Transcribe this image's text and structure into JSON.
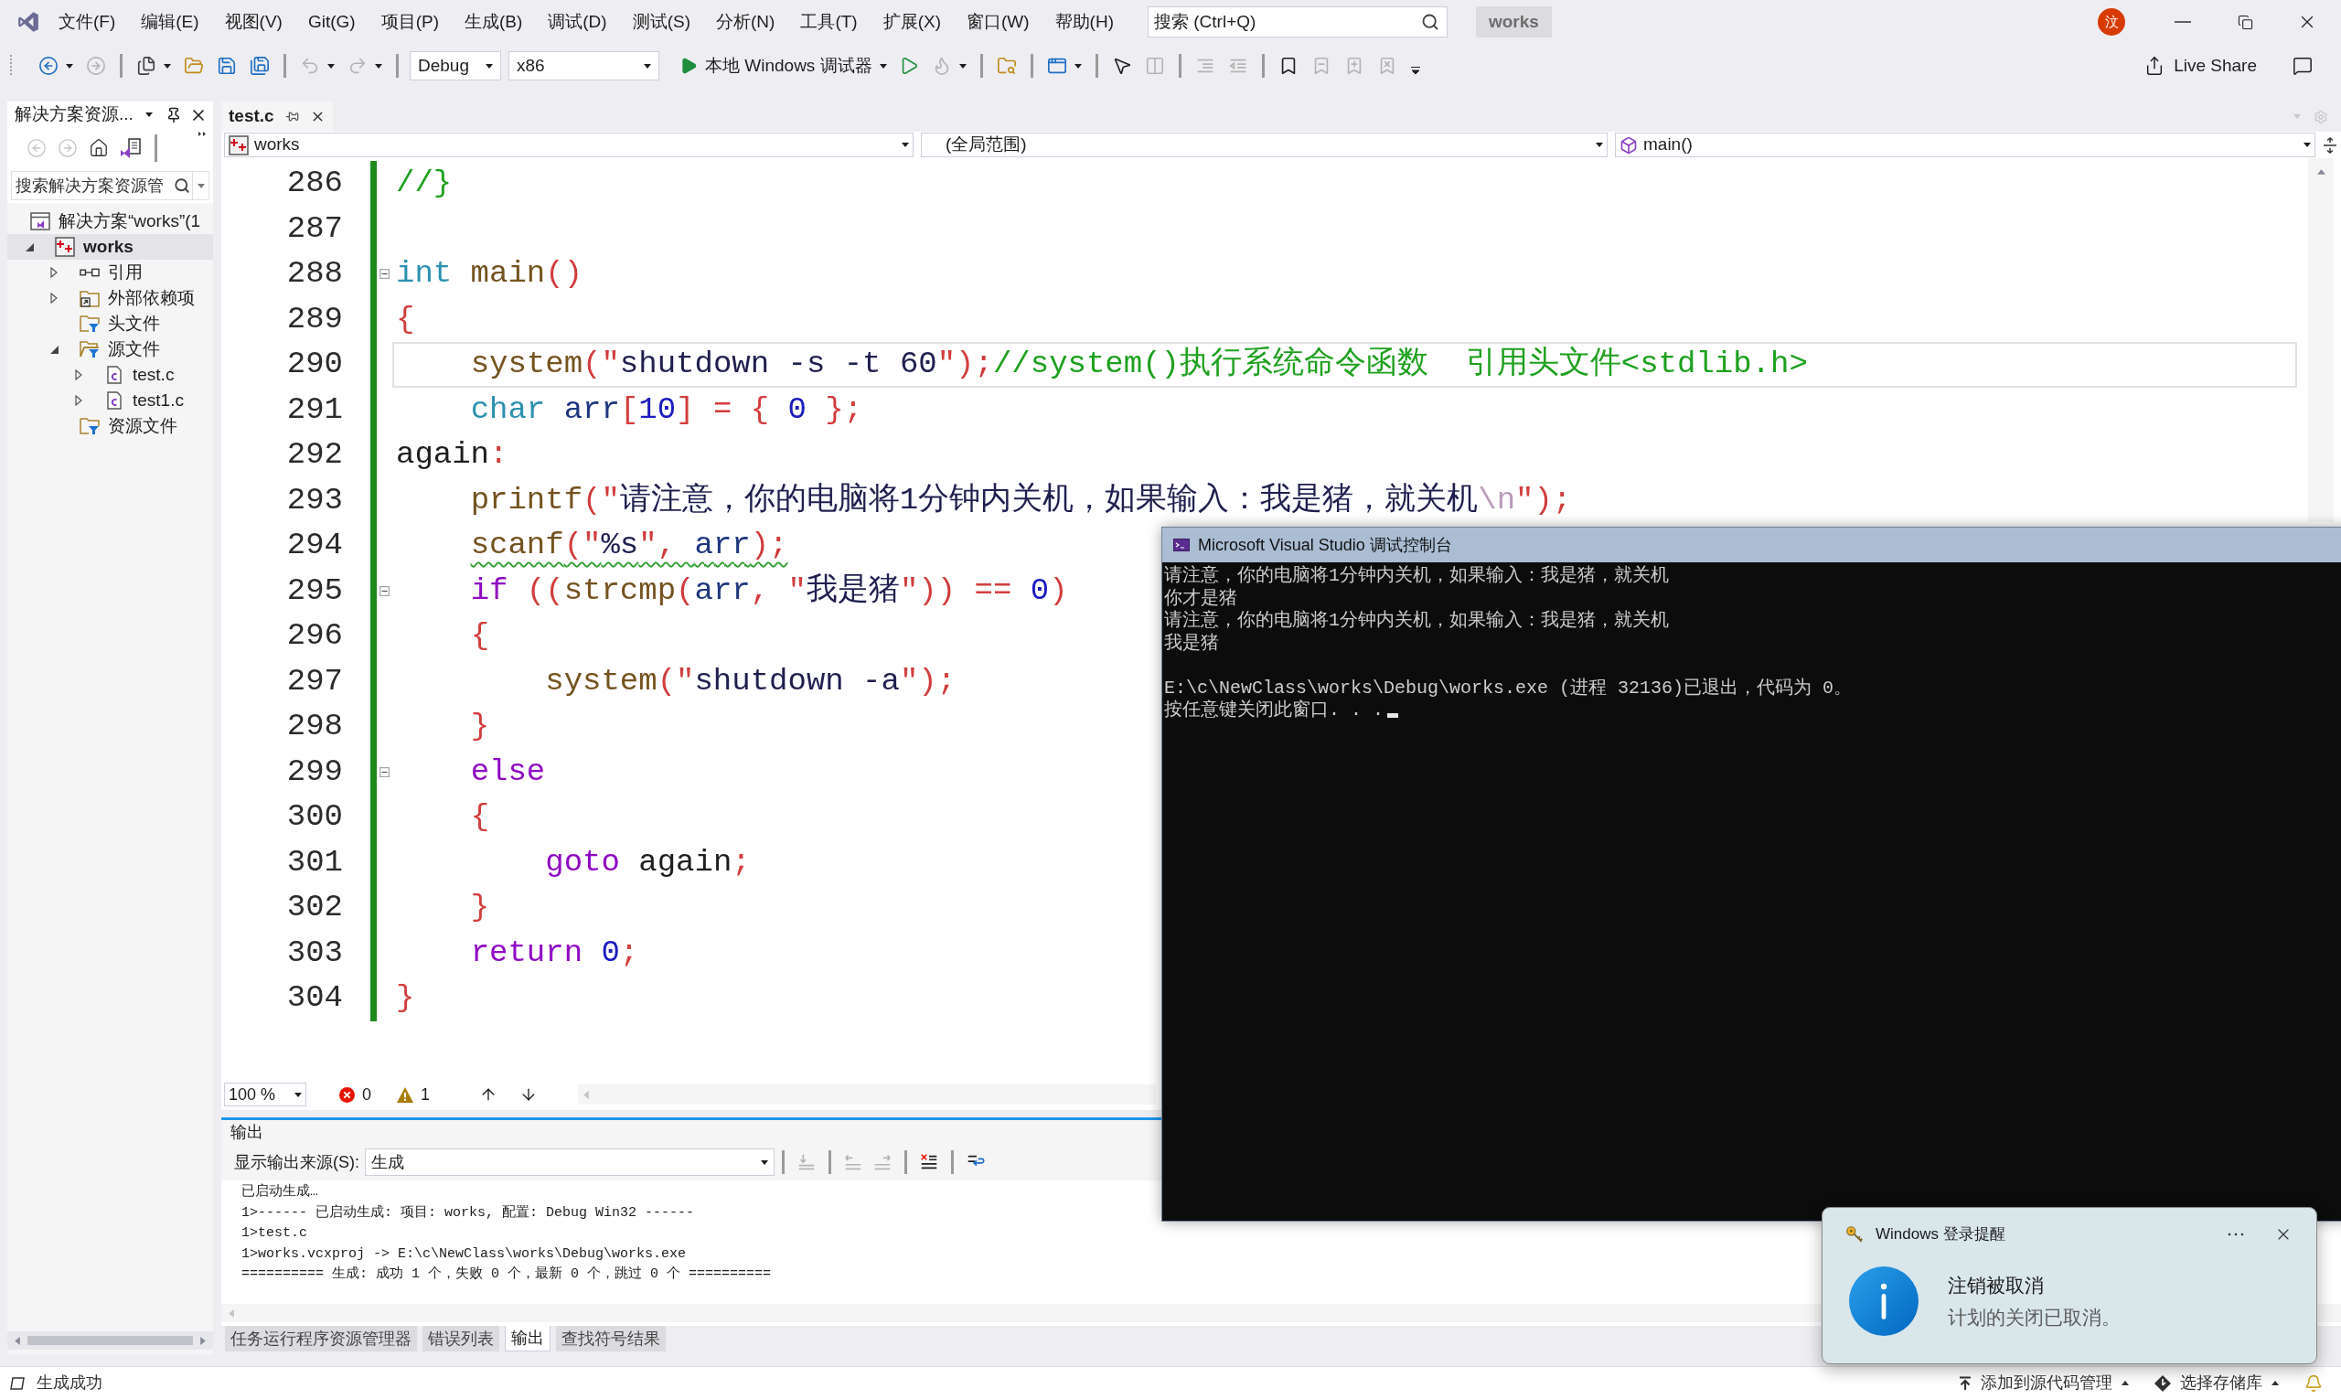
{
  "menu_bar": {
    "items": [
      "文件(F)",
      "编辑(E)",
      "视图(V)",
      "Git(G)",
      "项目(P)",
      "生成(B)",
      "调试(D)",
      "测试(S)",
      "分析(N)",
      "工具(T)",
      "扩展(X)",
      "窗口(W)",
      "帮助(H)"
    ],
    "search": {
      "placeholder": "搜索 (Ctrl+Q)"
    },
    "solution": "works",
    "avatar": "汶"
  },
  "toolbar": {
    "groups": [
      [
        {
          "kind": "back",
          "disabled": false,
          "menu": true
        },
        {
          "kind": "forward",
          "disabled": true,
          "menu": false
        }
      ],
      [
        {
          "kind": "new",
          "disabled": false,
          "menu": true
        },
        {
          "kind": "open",
          "disabled": false,
          "menu": false
        },
        {
          "kind": "save",
          "disabled": false,
          "menu": false
        },
        {
          "kind": "saveall",
          "disabled": false,
          "menu": false
        }
      ],
      [
        {
          "kind": "undo",
          "disabled": true,
          "menu": true
        },
        {
          "kind": "redo",
          "disabled": true,
          "menu": true
        }
      ],
      [
        {
          "kind": "select",
          "value": "Debug"
        },
        {
          "kind": "select",
          "value": "x86"
        },
        {
          "kind": "run",
          "label": "本地 Windows 调试器",
          "disabled": false,
          "menu": true
        },
        {
          "kind": "runnodebug",
          "disabled": false,
          "menu": false
        },
        {
          "kind": "hotreload",
          "disabled": true,
          "menu": true
        }
      ],
      [
        {
          "kind": "findfiles",
          "disabled": false,
          "menu": false
        }
      ],
      [
        {
          "kind": "layout",
          "disabled": false,
          "menu": true
        }
      ],
      [
        {
          "kind": "pointer",
          "disabled": false,
          "menu": false
        },
        {
          "kind": "columns",
          "disabled": true,
          "menu": false
        }
      ],
      [
        {
          "kind": "indent",
          "disabled": true,
          "menu": false
        },
        {
          "kind": "outdent",
          "disabled": true,
          "menu": false
        }
      ],
      [
        {
          "kind": "bookmark",
          "disabled": false,
          "menu": false
        },
        {
          "kind": "bookmarkprev",
          "disabled": true,
          "menu": false
        },
        {
          "kind": "bookmarknext",
          "disabled": true,
          "menu": false
        },
        {
          "kind": "bookmarkclear",
          "disabled": true,
          "menu": false
        }
      ]
    ],
    "live_share": "Live Share"
  },
  "solution_explorer": {
    "title": "解决方案资源...",
    "tools": [
      {
        "kind": "back",
        "disabled": true
      },
      {
        "kind": "forward",
        "disabled": true
      },
      {
        "kind": "home",
        "disabled": false
      },
      {
        "kind": "views",
        "disabled": false
      }
    ],
    "search": {
      "placeholder": "搜索解决方案资源管"
    },
    "tree": [
      {
        "label": "解决方案“works”(1",
        "kind": "solution",
        "selected": false,
        "children": [
          {
            "label": "works",
            "kind": "project",
            "expanded": true,
            "selected": true,
            "children": [
              {
                "label": "引用",
                "kind": "references",
                "expanded": false,
                "selected": false
              },
              {
                "label": "外部依赖项",
                "kind": "external",
                "expanded": false,
                "selected": false
              },
              {
                "label": "头文件",
                "kind": "filter",
                "selected": false
              },
              {
                "label": "源文件",
                "kind": "filter",
                "expanded": true,
                "selected": false,
                "children": [
                  {
                    "label": "test.c",
                    "kind": "file",
                    "expanded": false,
                    "selected": false
                  },
                  {
                    "label": "test1.c",
                    "kind": "file",
                    "expanded": false,
                    "selected": false
                  }
                ]
              },
              {
                "label": "资源文件",
                "kind": "filter",
                "selected": false
              }
            ]
          }
        ]
      }
    ]
  },
  "editor": {
    "tabs": [
      {
        "label": "test.c",
        "selected": true
      }
    ],
    "navigation": {
      "project": "works",
      "scope": "(全局范围)",
      "member": "main()"
    },
    "lines": [
      {
        "number": "286",
        "fold": false,
        "current": false,
        "warning": false,
        "tokens": [
          {
            "kind": "comment",
            "text": "//}"
          }
        ]
      },
      {
        "number": "287",
        "fold": false,
        "current": false,
        "warning": false
      },
      {
        "number": "288",
        "fold": true,
        "current": false,
        "warning": false,
        "tokens": [
          {
            "kind": "type",
            "text": "int"
          },
          {
            "kind": "function",
            "text": " main"
          },
          {
            "kind": "punct",
            "text": "()"
          }
        ]
      },
      {
        "number": "289",
        "fold": false,
        "current": false,
        "warning": false,
        "tokens": [
          {
            "kind": "punct",
            "text": "{"
          }
        ]
      },
      {
        "number": "290",
        "fold": false,
        "current": true,
        "warning": false,
        "tokens": [
          {
            "kind": "function",
            "text": "    system"
          },
          {
            "kind": "punct",
            "text": "(\""
          },
          {
            "kind": "string",
            "text": "shutdown -s -t 60"
          },
          {
            "kind": "punct",
            "text": "\");"
          },
          {
            "kind": "comment",
            "text": "//system()执行系统命令函数  引用头文件<stdlib.h>"
          }
        ]
      },
      {
        "number": "291",
        "fold": false,
        "current": false,
        "warning": false,
        "tokens": [
          {
            "kind": "type",
            "text": "    char"
          },
          {
            "kind": "variable",
            "text": " arr"
          },
          {
            "kind": "punct",
            "text": "["
          },
          {
            "kind": "number",
            "text": "10"
          },
          {
            "kind": "punct",
            "text": "] = { "
          },
          {
            "kind": "number",
            "text": "0"
          },
          {
            "kind": "punct",
            "text": " };"
          }
        ]
      },
      {
        "number": "292",
        "fold": false,
        "current": false,
        "warning": false,
        "tokens": [
          {
            "kind": "plain",
            "text": "again"
          },
          {
            "kind": "punct",
            "text": ":"
          }
        ]
      },
      {
        "number": "293",
        "fold": false,
        "current": false,
        "warning": false,
        "tokens": [
          {
            "kind": "function",
            "text": "    printf"
          },
          {
            "kind": "punct",
            "text": "(\""
          },
          {
            "kind": "string",
            "text": "请注意，你的电脑将1分钟内关机，如果输入：我是猪，就关机"
          },
          {
            "kind": "escape",
            "text": "\\n"
          },
          {
            "kind": "punct",
            "text": "\");"
          }
        ]
      },
      {
        "number": "294",
        "fold": false,
        "current": false,
        "warning": true,
        "tokens": [
          {
            "kind": "function",
            "text": "    scanf"
          },
          {
            "kind": "punct",
            "text": "(\""
          },
          {
            "kind": "string",
            "text": "%s"
          },
          {
            "kind": "punct",
            "text": "\", "
          },
          {
            "kind": "variable",
            "text": "arr"
          },
          {
            "kind": "punct",
            "text": ");"
          }
        ]
      },
      {
        "number": "295",
        "fold": true,
        "current": false,
        "warning": false,
        "tokens": [
          {
            "kind": "control",
            "text": "    if"
          },
          {
            "kind": "punct",
            "text": " (("
          },
          {
            "kind": "function",
            "text": "strcmp"
          },
          {
            "kind": "punct",
            "text": "("
          },
          {
            "kind": "variable",
            "text": "arr"
          },
          {
            "kind": "punct",
            "text": ", \""
          },
          {
            "kind": "string",
            "text": "我是猪"
          },
          {
            "kind": "punct",
            "text": "\")) == "
          },
          {
            "kind": "number",
            "text": "0"
          },
          {
            "kind": "punct",
            "text": ")"
          }
        ]
      },
      {
        "number": "296",
        "fold": false,
        "current": false,
        "warning": false,
        "tokens": [
          {
            "kind": "punct",
            "text": "    {"
          }
        ]
      },
      {
        "number": "297",
        "fold": false,
        "current": false,
        "warning": false,
        "tokens": [
          {
            "kind": "function",
            "text": "        system"
          },
          {
            "kind": "punct",
            "text": "(\""
          },
          {
            "kind": "string",
            "text": "shutdown -a"
          },
          {
            "kind": "punct",
            "text": "\");"
          }
        ]
      },
      {
        "number": "298",
        "fold": false,
        "current": false,
        "warning": false,
        "tokens": [
          {
            "kind": "punct",
            "text": "    }"
          }
        ]
      },
      {
        "number": "299",
        "fold": true,
        "current": false,
        "warning": false,
        "tokens": [
          {
            "kind": "control",
            "text": "    else"
          }
        ]
      },
      {
        "number": "300",
        "fold": false,
        "current": false,
        "warning": false,
        "tokens": [
          {
            "kind": "punct",
            "text": "    {"
          }
        ]
      },
      {
        "number": "301",
        "fold": false,
        "current": false,
        "warning": false,
        "tokens": [
          {
            "kind": "control",
            "text": "        goto"
          },
          {
            "kind": "plain",
            "text": " again"
          },
          {
            "kind": "punct",
            "text": ";"
          }
        ]
      },
      {
        "number": "302",
        "fold": false,
        "current": false,
        "warning": false,
        "tokens": [
          {
            "kind": "punct",
            "text": "    }"
          }
        ]
      },
      {
        "number": "303",
        "fold": false,
        "current": false,
        "warning": false,
        "tokens": [
          {
            "kind": "control",
            "text": "    return"
          },
          {
            "kind": "number",
            "text": " 0"
          },
          {
            "kind": "punct",
            "text": ";"
          }
        ]
      },
      {
        "number": "304",
        "fold": false,
        "current": false,
        "warning": false,
        "tokens": [
          {
            "kind": "punct",
            "text": "}"
          }
        ]
      }
    ],
    "zoom": "100 %",
    "errors": "0",
    "warnings": "1"
  },
  "console": {
    "title": "Microsoft Visual Studio 调试控制台",
    "blocks": [
      [
        "请注意，你的电脑将1分钟内关机，如果输入：我是猪，就关机",
        "你才是猪",
        "请注意，你的电脑将1分钟内关机，如果输入：我是猪，就关机",
        "我是猪"
      ],
      [
        "E:\\c\\NewClass\\works\\Debug\\works.exe (进程 32136)已退出，代码为 0。",
        "按任意键关闭此窗口. . ."
      ]
    ]
  },
  "output": {
    "title": "输出",
    "source_label": "显示输出来源(S):",
    "source": "生成",
    "tools": [
      [
        {
          "kind": "goto",
          "disabled": true
        }
      ],
      [
        {
          "kind": "prev",
          "disabled": true
        },
        {
          "kind": "next",
          "disabled": true
        }
      ],
      [
        {
          "kind": "clear",
          "disabled": false
        }
      ],
      [
        {
          "kind": "wrap",
          "disabled": false
        }
      ]
    ],
    "lines": [
      "已启动生成…",
      "1>------ 已启动生成: 项目: works, 配置: Debug Win32 ------",
      "1>test.c",
      "1>works.vcxproj -> E:\\c\\NewClass\\works\\Debug\\works.exe",
      "========== 生成: 成功 1 个，失败 0 个，最新 0 个，跳过 0 个 =========="
    ]
  },
  "bottom_tabs": [
    {
      "label": "任务运行程序资源管理器",
      "selected": false
    },
    {
      "label": "错误列表",
      "selected": false
    },
    {
      "label": "输出",
      "selected": true
    },
    {
      "label": "查找符号结果",
      "selected": false
    }
  ],
  "status_bar": {
    "message": "生成成功",
    "items": [
      "添加到源代码管理",
      "选择存储库"
    ]
  },
  "notification": {
    "app": "Windows 登录提醒",
    "title": "注销被取消",
    "body": "计划的关闭已取消。"
  }
}
